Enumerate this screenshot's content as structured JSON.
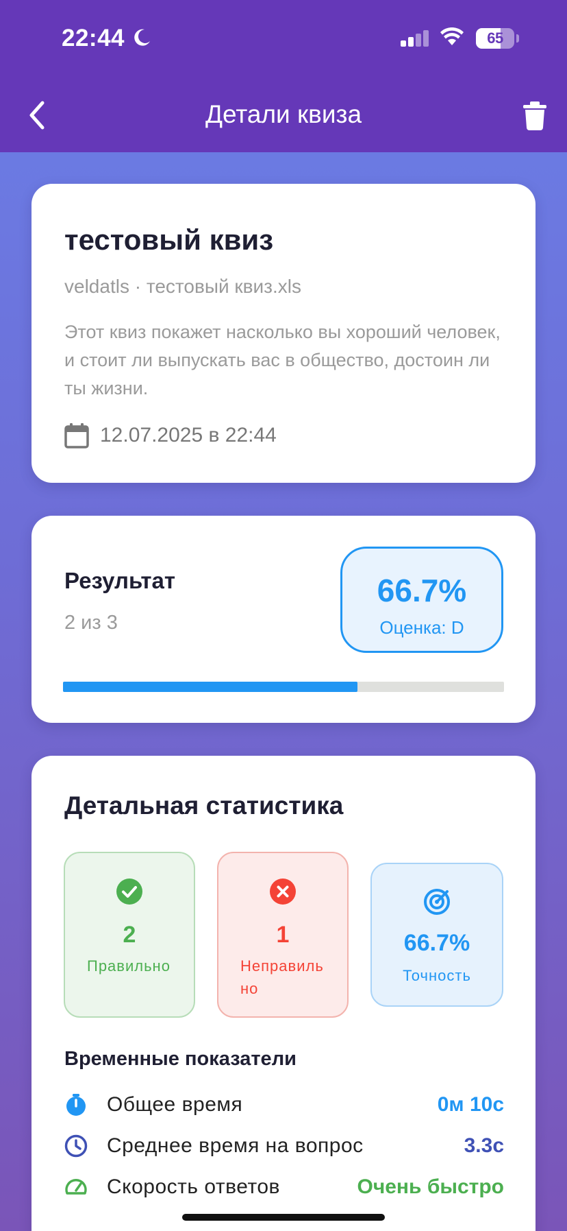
{
  "status_bar": {
    "time": "22:44",
    "battery": "65",
    "battery_level": 0.65
  },
  "header": {
    "title": "Детали квиза"
  },
  "quiz": {
    "title": "тестовый квиз",
    "subtitle": "veldatls · тестовый квиз.xls",
    "description": "Этот квиз покажет насколько вы хороший человек, и стоит ли выпускать вас в общество, достоин ли ты жизни.",
    "date": "12.07.2025 в 22:44"
  },
  "result": {
    "label": "Результат",
    "count": "2 из 3",
    "percent": "66.7%",
    "grade": "Оценка: D",
    "progress": 0.667
  },
  "stats": {
    "title": "Детальная статистика",
    "correct": {
      "value": "2",
      "label": "Правильно"
    },
    "wrong": {
      "value": "1",
      "label": "Неправильно"
    },
    "accuracy": {
      "value": "66.7%",
      "label": "Точность"
    },
    "time_title": "Временные показатели",
    "rows": [
      {
        "label": "Общее время",
        "value": "0м 10с"
      },
      {
        "label": "Среднее время на вопрос",
        "value": "3.3с"
      },
      {
        "label": "Скорость ответов",
        "value": "Очень быстро"
      }
    ]
  },
  "colors": {
    "header": "#6538b8",
    "accent_blue": "#2196f3",
    "green": "#4caf50",
    "red": "#f44336",
    "indigo": "#3f51b5"
  }
}
